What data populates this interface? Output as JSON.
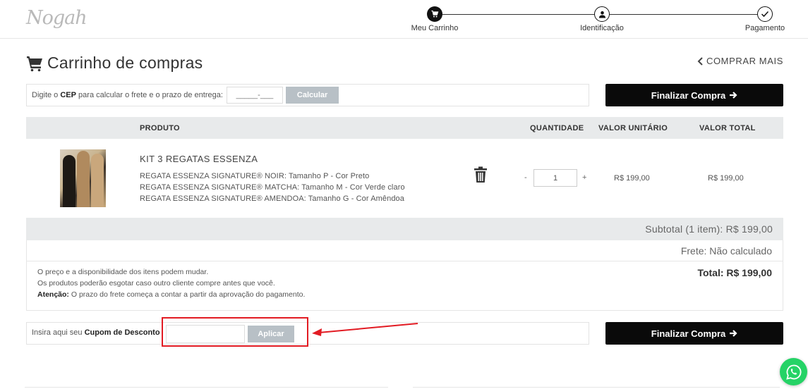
{
  "header": {
    "logo": "Nogah",
    "steps": [
      {
        "label": "Meu Carrinho",
        "icon": "cart-icon",
        "state": "active"
      },
      {
        "label": "Identificação",
        "icon": "user-icon",
        "state": "active"
      },
      {
        "label": "Pagamento",
        "icon": "check-icon",
        "state": "pending"
      }
    ]
  },
  "page": {
    "title": "Carrinho de compras",
    "buy_more": "COMPRAR MAIS"
  },
  "cep": {
    "label_prefix": "Digite o ",
    "label_bold": "CEP",
    "label_suffix": " para calcular o frete e o prazo de entrega:",
    "placeholder": "_____-___",
    "button": "Calcular"
  },
  "checkout_button": "Finalizar Compra",
  "table": {
    "headers": {
      "product": "PRODUTO",
      "quantity": "QUANTIDADE",
      "unit_price": "VALOR UNITÁRIO",
      "total_price": "VALOR TOTAL"
    },
    "items": [
      {
        "name": "KIT 3 REGATAS ESSENZA",
        "variants": [
          "REGATA ESSENZA SIGNATURE® NOIR: Tamanho P - Cor Preto",
          "REGATA ESSENZA SIGNATURE® MATCHA: Tamanho M - Cor Verde claro",
          "REGATA ESSENZA SIGNATURE® AMENDOA: Tamanho G - Cor Amêndoa"
        ],
        "quantity": "1",
        "minus": "-",
        "plus": "+",
        "unit_price": "R$ 199,00",
        "total_price": "R$ 199,00"
      }
    ]
  },
  "summary": {
    "subtotal": "Subtotal (1 item): R$ 199,00",
    "frete": "Frete: Não calculado",
    "total": "Total: R$ 199,00",
    "notice_1": "O preço e a disponibilidade dos itens podem mudar.",
    "notice_2": "Os produtos poderão esgotar caso outro cliente compre antes que você.",
    "notice_3_bold": "Atenção:",
    "notice_3": " O prazo do frete começa a contar a partir da aprovação do pagamento."
  },
  "coupon": {
    "label_prefix": "Insira aqui seu ",
    "label_bold": "Cupom de Desconto",
    "value": "",
    "button": "Aplicar"
  },
  "colors": {
    "accent_dark": "#0a0a0a",
    "disabled_button": "#b8c0c6",
    "annotation_red": "#e21b23",
    "whatsapp": "#25d366"
  }
}
